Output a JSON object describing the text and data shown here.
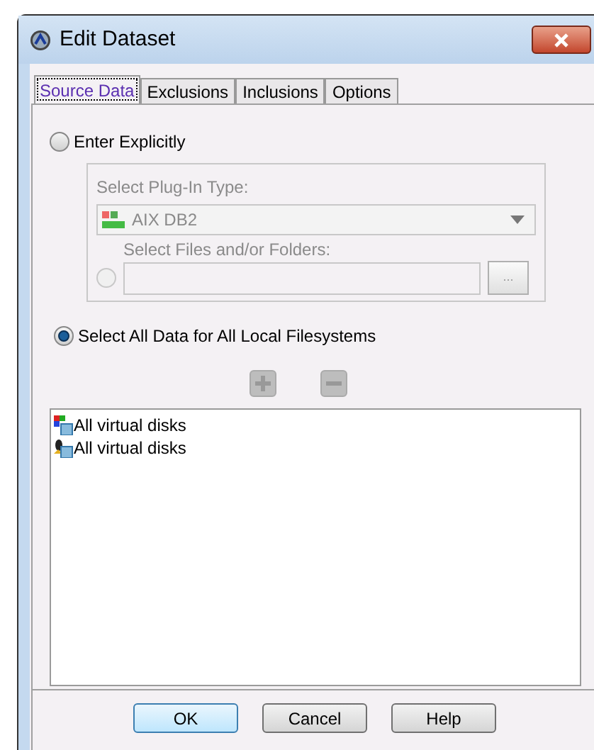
{
  "window": {
    "title": "Edit Dataset"
  },
  "tabs": [
    {
      "label": "Source Data",
      "selected": true
    },
    {
      "label": "Exclusions",
      "selected": false
    },
    {
      "label": "Inclusions",
      "selected": false
    },
    {
      "label": "Options",
      "selected": false
    }
  ],
  "enter_explicitly": {
    "label": "Enter Explicitly",
    "selected": false
  },
  "plugin_type": {
    "label": "Select Plug-In Type:",
    "value": "AIX DB2",
    "disabled": true
  },
  "files": {
    "label": "Select Files and/or Folders:",
    "selected": false,
    "disabled": true,
    "browse": "..."
  },
  "select_all": {
    "label": "Select All Data for All Local Filesystems",
    "selected": true
  },
  "list_items": [
    {
      "kind": "windows",
      "label": "All virtual disks"
    },
    {
      "kind": "linux",
      "label": "All virtual disks"
    }
  ],
  "buttons": [
    {
      "label": "OK",
      "default": true
    },
    {
      "label": "Cancel",
      "default": false
    },
    {
      "label": "Help",
      "default": false
    }
  ]
}
